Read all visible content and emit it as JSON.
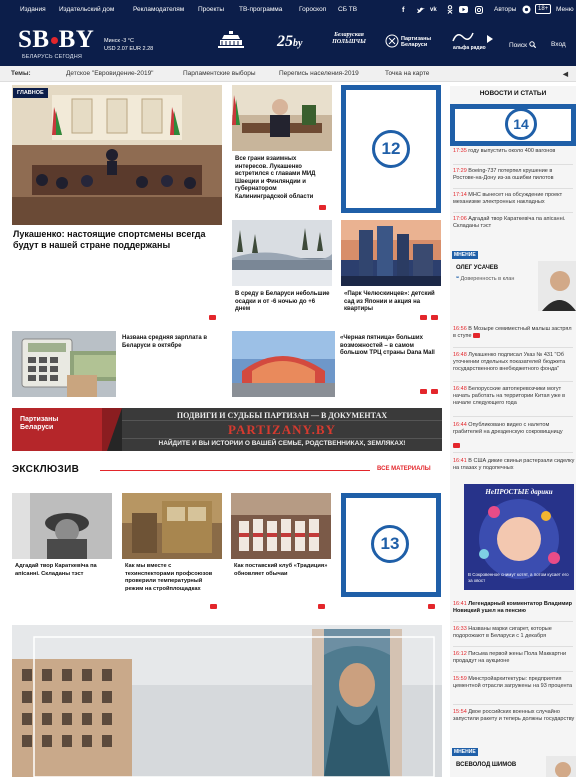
{
  "topnav": {
    "items": [
      "Издания",
      "Издательский дом",
      "Рекламодателям",
      "Проекты",
      "ТВ-программа",
      "Гороскоп",
      "СБ ТВ"
    ],
    "social": [
      "f",
      "v",
      "vk",
      "ok",
      "yt",
      "ig"
    ],
    "authors": "Авторы",
    "age": "18+",
    "menu": "Меню"
  },
  "header": {
    "logo": "SB BY",
    "logo_left": "SB",
    "logo_right": "BY",
    "subtitle": "БЕЛАРУСЬ СЕГОДНЯ",
    "weather_city": "Минск -3 °С",
    "rates": "USD 2.07   EUR 2.28",
    "logo_25": "25",
    "logo_25_suffix": "by",
    "logo_bp": "Беларуская ПОЛЬШЧЫ",
    "logo_partisans": "Партизаны Беларуси",
    "logo_alpha": "альфа радио",
    "search": "Поиск",
    "login": "Вход"
  },
  "themes": {
    "label": "Темы:",
    "items": [
      "Детское \"Евровидение-2019\"",
      "Парламентские выборы",
      "Перепись населения-2019",
      "Точка на карте"
    ]
  },
  "main": {
    "tag": "ГЛАВНОЕ",
    "big_title": "Лукашенко: настоящие спортсмены всегда будут в нашей стране поддержаны",
    "card1": "Все грани взаимных интересов. Лукашенко встретился с главами МИД Швеции и Финляндии и губернатором Калининградской области",
    "card2": "В среду в Беларуси небольшие осадки и от -6 ночью до +6 днем",
    "card3": "«Парк Челюскинцев»: детский сад из Японии и акция на квартиры",
    "card4": "Названа средняя зарплата в Беларуси в октябре",
    "card5": "«Черная пятница» больших возможностей – в самом большом ТРЦ страны Dana Mall",
    "placeholder12": "12",
    "placeholder13": "13",
    "placeholder14": "14"
  },
  "banner": {
    "headline": "ПОДВИГИ И СУДЬБЫ ПАРТИЗАН — В ДОКУМЕНТАХ",
    "site": "PARTIZANY.BY",
    "footer": "НАЙДИТЕ И ВЫ ИСТОРИИ О ВАШЕЙ СЕМЬЕ, РОДСТВЕННИКАХ, ЗЕМЛЯКАХ!",
    "brand": "Партизаны Беларуси"
  },
  "exclusive": {
    "title": "ЭКСКЛЮЗИВ",
    "all": "ВСЕ МАТЕРИАЛЫ",
    "cards": [
      "Адгадай твор Караткевіча па апісанні. Складаны тэст",
      "Как мы вместе с техинспекторами профсоюзов проверили температурный режим на стройплощадках",
      "Как поставский клуб «Традиция» обновляет обычаи"
    ]
  },
  "sidebar": {
    "header": "НОВОСТИ И СТАТЬИ",
    "top_fragment_time": "17:35",
    "top_fragment": "году выпустить около 400 вагонов",
    "news": [
      {
        "time": "17:29",
        "text": "Boeing-737 потерпел крушение в Ростове-на-Дону из-за ошибки пилотов"
      },
      {
        "time": "17:14",
        "text": "МНС вынесет на обсуждение проект механизме электронных накладных"
      },
      {
        "time": "17:06",
        "text": "Адгадай твор Караткевіча па апісанні. Складаны тэст"
      }
    ],
    "opinion1": {
      "tag": "МНЕНИЕ",
      "name": "ОЛЕГ УСАЧЕВ",
      "text": "Доверенность в клан"
    },
    "news2": [
      {
        "time": "16:56",
        "text": "В Мозыре семиместный малыш застрял в ступе"
      },
      {
        "time": "16:48",
        "text": "Лукашенко подписал Указ № 431 \"Об уточнении отдельных показателей бюджета государственного внебюджетного фонда\""
      },
      {
        "time": "16:48",
        "text": "Белорусские автоперевозчики могут начать работать на территории Китая уже в начале следующего года"
      },
      {
        "time": "16:44",
        "text": "Опубликовано видео с налетом грабителей на дрезденскую сокровищницу"
      },
      {
        "time": "16:41",
        "text": "В США дикие свиньи растерзали сиделку на глазах у подопечных"
      }
    ],
    "promo_title": "НеПРОСТЫЕ дарики",
    "promo_caption": "В Сокровенное снимут котят, а потом кусает его за хвост",
    "news3": [
      {
        "time": "16:41",
        "text": "Легендарный комментатор Владимир Новицкий ушел на пенсию",
        "bold": true
      },
      {
        "time": "16:33",
        "text": "Названы марки сигарет, которые подорожают в Беларуси с 1 декабря"
      },
      {
        "time": "16:12",
        "text": "Письма первой жены Пола Маккартни продадут на аукционе"
      },
      {
        "time": "15:59",
        "text": "Минстройархитектуры: предприятия цементной отрасли загружены на 93 процента"
      },
      {
        "time": "15:54",
        "text": "Двое российских военных случайно запустили ракету и теперь должны государству"
      }
    ],
    "opinion2": {
      "tag": "МНЕНИЕ",
      "name": "ВСЕВОЛОД ШИМОВ"
    }
  }
}
